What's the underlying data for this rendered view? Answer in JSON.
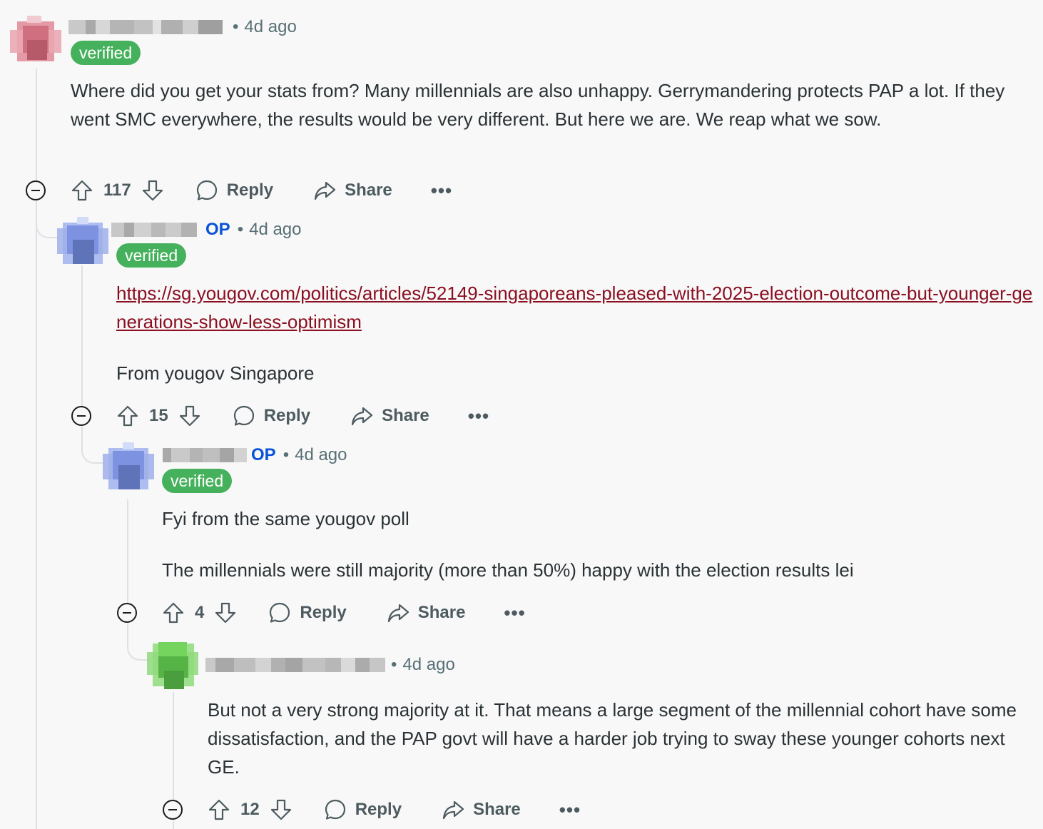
{
  "comments": [
    {
      "time": "4d ago",
      "badge": "verified",
      "body": [
        "Where did you get your stats from? Many millennials are also unhappy. Gerrymandering protects PAP a lot. If they went SMC everywhere, the results would be very different. But here we are. We reap what we sow."
      ],
      "votes": "117",
      "reply": "Reply",
      "share": "Share",
      "more": "•••",
      "avatar_color": "#d9788a"
    },
    {
      "op": "OP",
      "time": "4d ago",
      "badge": "verified",
      "link": "https://sg.yougov.com/politics/articles/52149-singaporeans-pleased-with-2025-election-outcome-but-younger-generations-show-less-optimism",
      "body": [
        "From yougov Singapore"
      ],
      "votes": "15",
      "reply": "Reply",
      "share": "Share",
      "more": "•••",
      "avatar_color": "#6f86d6"
    },
    {
      "op": "OP",
      "time": "4d ago",
      "badge": "verified",
      "body": [
        "Fyi from the same yougov poll",
        "The millennials were still majority (more than 50%) happy with the election results lei"
      ],
      "votes": "4",
      "reply": "Reply",
      "share": "Share",
      "more": "•••",
      "avatar_color": "#6f86d6"
    },
    {
      "time": "4d ago",
      "body": [
        "But not a very strong majority at it. That means a large segment of the millennial cohort have some dissatisfaction, and the PAP govt will have a harder job trying to sway these younger cohorts next GE."
      ],
      "votes": "12",
      "reply": "Reply",
      "share": "Share",
      "more": "•••",
      "avatar_color": "#5cc24a"
    }
  ]
}
